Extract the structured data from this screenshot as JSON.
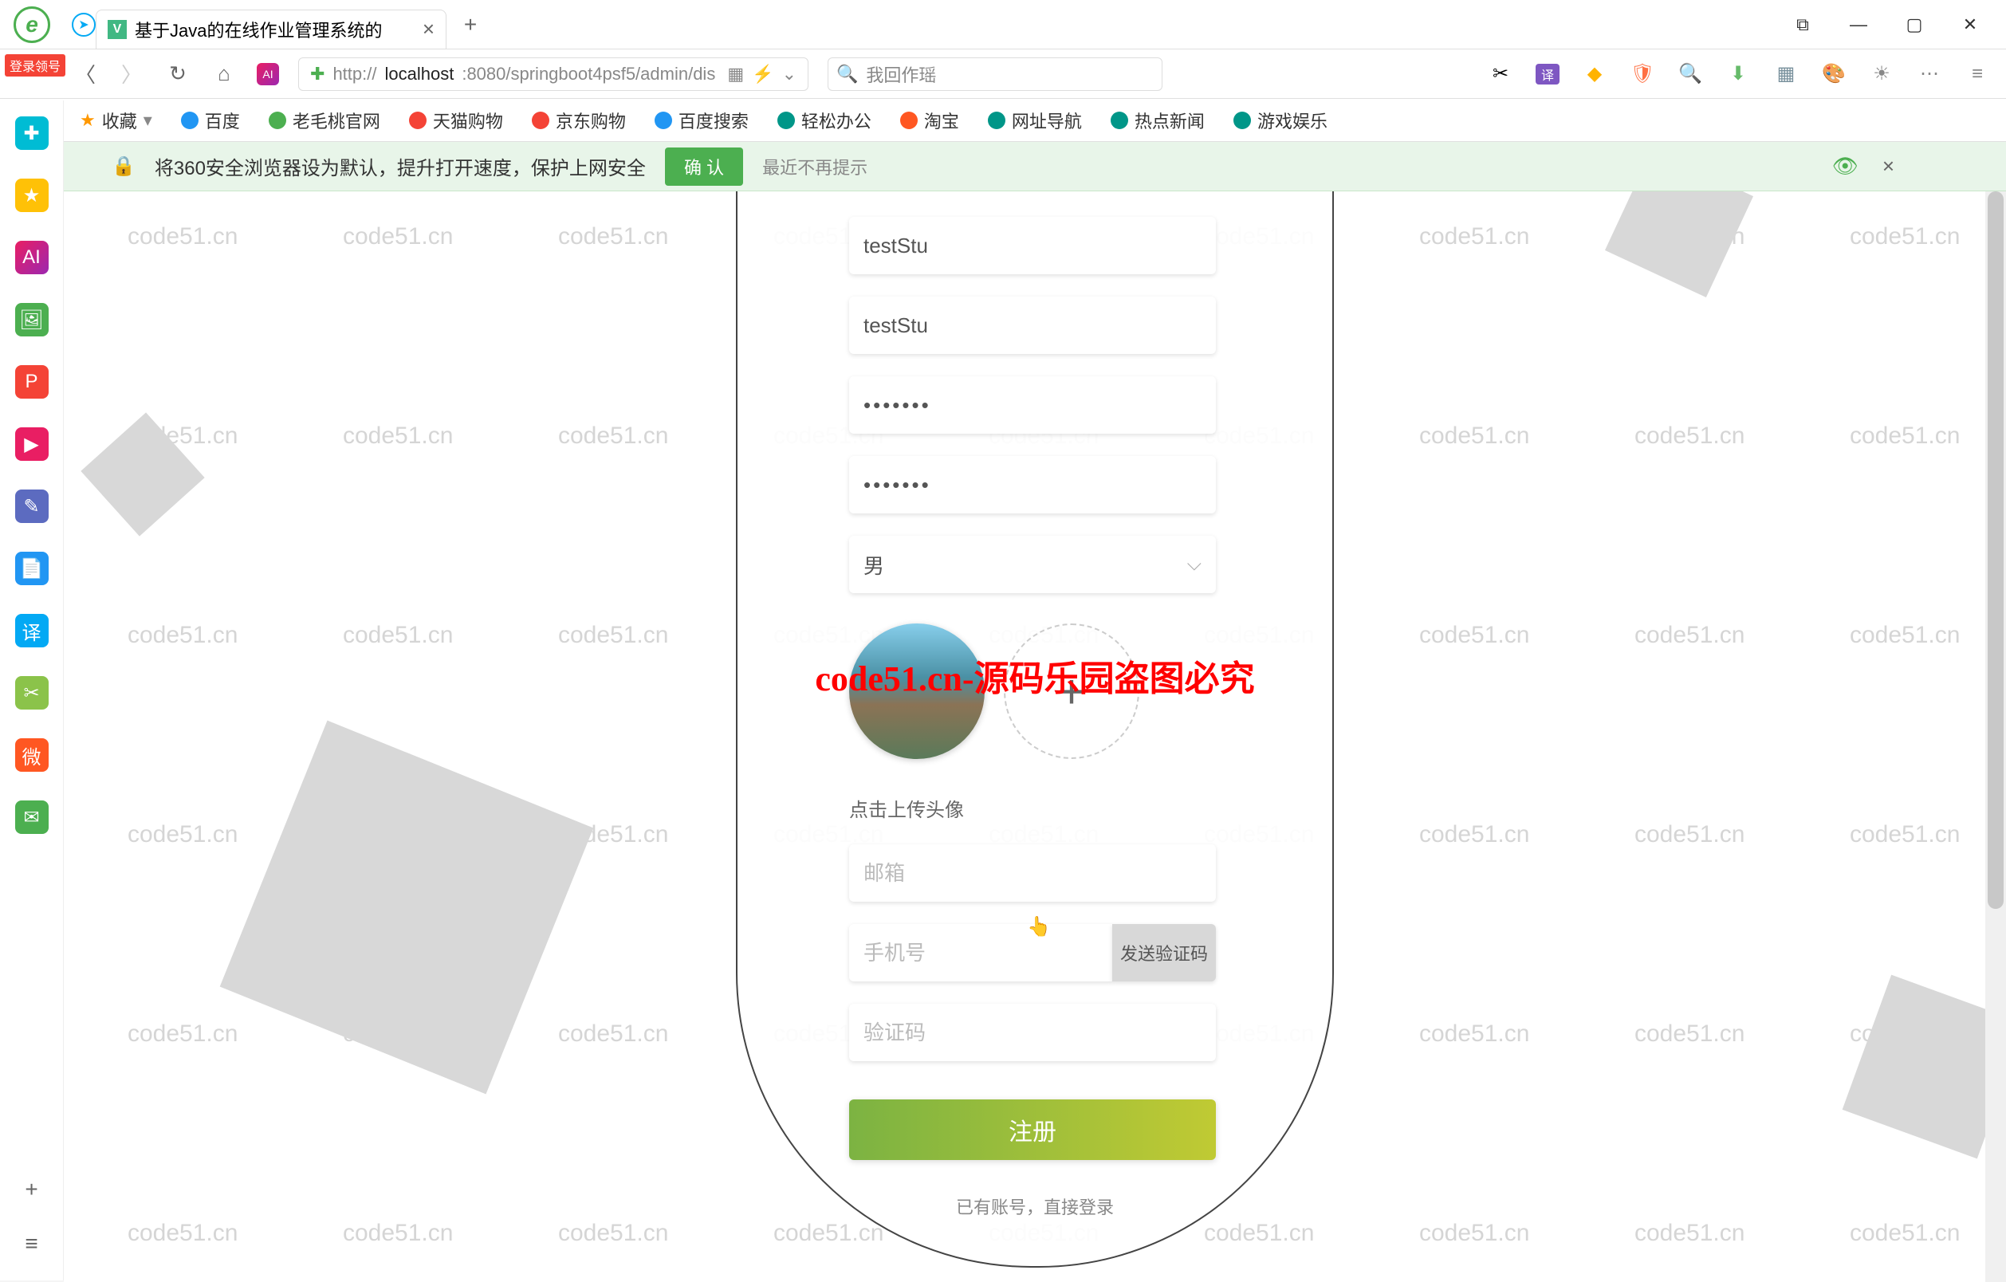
{
  "browser": {
    "tab_title": "基于Java的在线作业管理系统的",
    "url_proto": "http://",
    "url_host": "localhost",
    "url_path": ":8080/springboot4psf5/admin/dis",
    "search_placeholder": "我回作瑶",
    "login_badge": "登录领号"
  },
  "bookmarks": {
    "fav": "收藏",
    "items": [
      "百度",
      "老毛桃官网",
      "天猫购物",
      "京东购物",
      "百度搜索",
      "轻松办公",
      "淘宝",
      "网址导航",
      "热点新闻",
      "游戏娱乐"
    ]
  },
  "notice": {
    "text": "将360安全浏览器设为默认，提升打开速度，保护上网安全",
    "confirm": "确 认",
    "dismiss": "最近不再提示"
  },
  "watermark_text": "code51.cn",
  "red_watermark": "code51.cn-源码乐园盗图必究",
  "form": {
    "username_value": "testStu",
    "nickname_value": "testStu",
    "password_value": "•••••••",
    "confirm_value": "•••••••",
    "gender_value": "男",
    "avatar_hint": "点击上传头像",
    "email_placeholder": "邮箱",
    "phone_placeholder": "手机号",
    "send_code_label": "发送验证码",
    "captcha_placeholder": "验证码",
    "register_label": "注册",
    "login_link": "已有账号，直接登录"
  }
}
